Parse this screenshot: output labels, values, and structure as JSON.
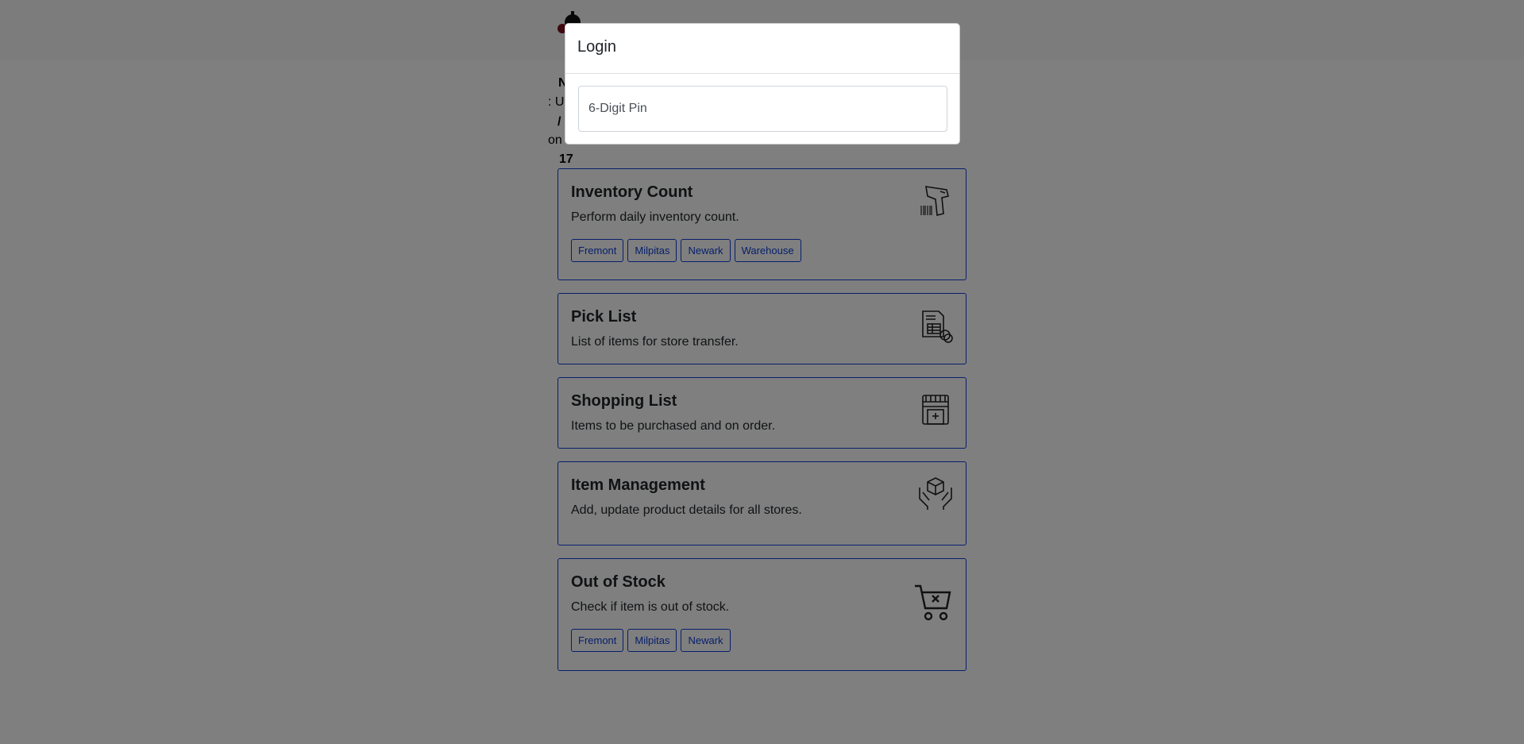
{
  "background": {
    "bold_letter": "N",
    "line2": ": U",
    "line3": "/",
    "line4": "on",
    "count": "17"
  },
  "cards": [
    {
      "title": "Inventory Count",
      "description": "Perform daily inventory count.",
      "icon": "barcode-scanner-icon",
      "tags": [
        "Fremont",
        "Milpitas",
        "Newark",
        "Warehouse"
      ]
    },
    {
      "title": "Pick List",
      "description": "List of items for store transfer.",
      "icon": "document-list-icon",
      "tags": []
    },
    {
      "title": "Shopping List",
      "description": "Items to be purchased and on order.",
      "icon": "storefront-icon",
      "tags": []
    },
    {
      "title": "Item Management",
      "description": "Add, update product details for all stores.",
      "icon": "hands-box-icon",
      "tags": []
    },
    {
      "title": "Out of Stock",
      "description": "Check if item is out of stock.",
      "icon": "cart-remove-icon",
      "tags": [
        "Fremont",
        "Milpitas",
        "Newark"
      ]
    }
  ],
  "modal": {
    "title": "Login",
    "pin_placeholder": "6-Digit Pin"
  },
  "colors": {
    "accent": "#0d3fd8",
    "overlay": "rgba(0,0,0,0.5)"
  }
}
